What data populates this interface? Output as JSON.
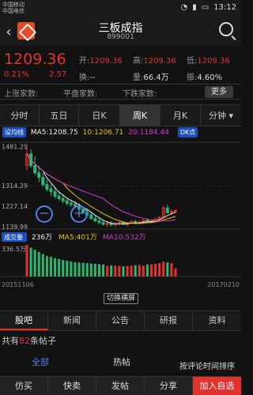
{
  "status": {
    "carrier_line1": "中国移动",
    "carrier_line2": "中国电信",
    "time": "13:12"
  },
  "header": {
    "title": "三板成指",
    "code": "899001"
  },
  "quote": {
    "price": "1209.36",
    "pct": "0.21%",
    "change": "2.57",
    "open_label": "开:",
    "open_value": "1209.36",
    "high_label": "高:",
    "high_value": "1209.36",
    "low_label": "低:",
    "low_value": "1209.36",
    "turnover_label": "换:",
    "turnover_value": "--",
    "volume_label": "量:",
    "volume_value": "66.4万",
    "amplitude_label": "振:",
    "amplitude_value": "4.60%"
  },
  "breadth": {
    "up_label": "上涨家数:",
    "up_value": "",
    "flat_label": "平盘家数:",
    "flat_value": "",
    "down_label": "下跌家数:",
    "down_value": "",
    "more_label": "更多"
  },
  "period_tabs": [
    "分时",
    "五日",
    "日K",
    "周K",
    "月K",
    "分钟"
  ],
  "active_period": "周K",
  "chart_data": {
    "type": "candlestick",
    "title": "",
    "indicator_badge": "设均线",
    "kline_badge": "DK点",
    "ma5_label": "MA5:1208.75",
    "ma10_label": "10:1206.71",
    "ma20_label": "20:1184.44",
    "y_ticks": [
      "1481.29",
      "1314.29",
      "1227.14",
      "1139.99"
    ],
    "y_range": [
      1130,
      1500
    ],
    "x_start": "20151106",
    "x_end": "20170210",
    "volume_badge": "成交量",
    "volume_label": "236万",
    "vol_ma5_label": "MA5:401万",
    "vol_ma10_label": "MA10:532万",
    "vol_tick": "336.5万",
    "candles": [
      {
        "o": 1400,
        "h": 1481,
        "l": 1380,
        "c": 1450
      },
      {
        "o": 1450,
        "h": 1470,
        "l": 1390,
        "c": 1400
      },
      {
        "o": 1400,
        "h": 1440,
        "l": 1360,
        "c": 1370
      },
      {
        "o": 1370,
        "h": 1400,
        "l": 1330,
        "c": 1350
      },
      {
        "o": 1350,
        "h": 1370,
        "l": 1310,
        "c": 1320
      },
      {
        "o": 1320,
        "h": 1340,
        "l": 1290,
        "c": 1300
      },
      {
        "o": 1300,
        "h": 1320,
        "l": 1270,
        "c": 1290
      },
      {
        "o": 1290,
        "h": 1310,
        "l": 1260,
        "c": 1270
      },
      {
        "o": 1270,
        "h": 1290,
        "l": 1250,
        "c": 1260
      },
      {
        "o": 1260,
        "h": 1280,
        "l": 1240,
        "c": 1250
      },
      {
        "o": 1250,
        "h": 1260,
        "l": 1230,
        "c": 1240
      },
      {
        "o": 1240,
        "h": 1255,
        "l": 1225,
        "c": 1235
      },
      {
        "o": 1235,
        "h": 1250,
        "l": 1220,
        "c": 1228
      },
      {
        "o": 1228,
        "h": 1240,
        "l": 1210,
        "c": 1215
      },
      {
        "o": 1215,
        "h": 1225,
        "l": 1195,
        "c": 1200
      },
      {
        "o": 1200,
        "h": 1215,
        "l": 1185,
        "c": 1190
      },
      {
        "o": 1190,
        "h": 1200,
        "l": 1170,
        "c": 1175
      },
      {
        "o": 1175,
        "h": 1190,
        "l": 1160,
        "c": 1165
      },
      {
        "o": 1165,
        "h": 1180,
        "l": 1150,
        "c": 1158
      },
      {
        "o": 1158,
        "h": 1170,
        "l": 1145,
        "c": 1150
      },
      {
        "o": 1150,
        "h": 1165,
        "l": 1140,
        "c": 1155
      },
      {
        "o": 1155,
        "h": 1165,
        "l": 1142,
        "c": 1148
      },
      {
        "o": 1148,
        "h": 1160,
        "l": 1140,
        "c": 1152
      },
      {
        "o": 1152,
        "h": 1162,
        "l": 1145,
        "c": 1158
      },
      {
        "o": 1158,
        "h": 1165,
        "l": 1148,
        "c": 1150
      },
      {
        "o": 1150,
        "h": 1160,
        "l": 1142,
        "c": 1155
      },
      {
        "o": 1155,
        "h": 1168,
        "l": 1150,
        "c": 1162
      },
      {
        "o": 1162,
        "h": 1170,
        "l": 1150,
        "c": 1155
      },
      {
        "o": 1155,
        "h": 1165,
        "l": 1148,
        "c": 1160
      },
      {
        "o": 1160,
        "h": 1172,
        "l": 1152,
        "c": 1168
      },
      {
        "o": 1168,
        "h": 1175,
        "l": 1158,
        "c": 1162
      },
      {
        "o": 1162,
        "h": 1170,
        "l": 1155,
        "c": 1165
      },
      {
        "o": 1165,
        "h": 1178,
        "l": 1160,
        "c": 1172
      },
      {
        "o": 1172,
        "h": 1185,
        "l": 1165,
        "c": 1180
      },
      {
        "o": 1180,
        "h": 1230,
        "l": 1175,
        "c": 1220
      },
      {
        "o": 1220,
        "h": 1235,
        "l": 1195,
        "c": 1200
      },
      {
        "o": 1200,
        "h": 1215,
        "l": 1190,
        "c": 1205
      },
      {
        "o": 1205,
        "h": 1215,
        "l": 1195,
        "c": 1209
      }
    ],
    "volumes": [
      900,
      820,
      760,
      700,
      640,
      580,
      560,
      520,
      500,
      470,
      450,
      430,
      410,
      400,
      390,
      380,
      370,
      360,
      350,
      340,
      300,
      320,
      310,
      300,
      290,
      300,
      310,
      320,
      330,
      310,
      340,
      350,
      360,
      380,
      420,
      400,
      380,
      236
    ],
    "ma_colors": {
      "ma5": "#eeeeee",
      "ma10": "#e8c300",
      "ma20": "#d13ad1"
    },
    "up_color": "#e3322e",
    "down_color": "#2bb673"
  },
  "switch_label": "切换横屏",
  "section_tabs": [
    "股吧",
    "新闻",
    "公告",
    "研报",
    "资料"
  ],
  "active_section": "股吧",
  "posts": {
    "prefix": "共有",
    "count": "82",
    "suffix": "条帖子"
  },
  "sub_tabs": {
    "all": "全部",
    "hot": "热帖",
    "sort": "按评论时间排序"
  },
  "bottom_bar": [
    "仿买",
    "快卖",
    "发帖",
    "分享",
    "加入自选"
  ]
}
